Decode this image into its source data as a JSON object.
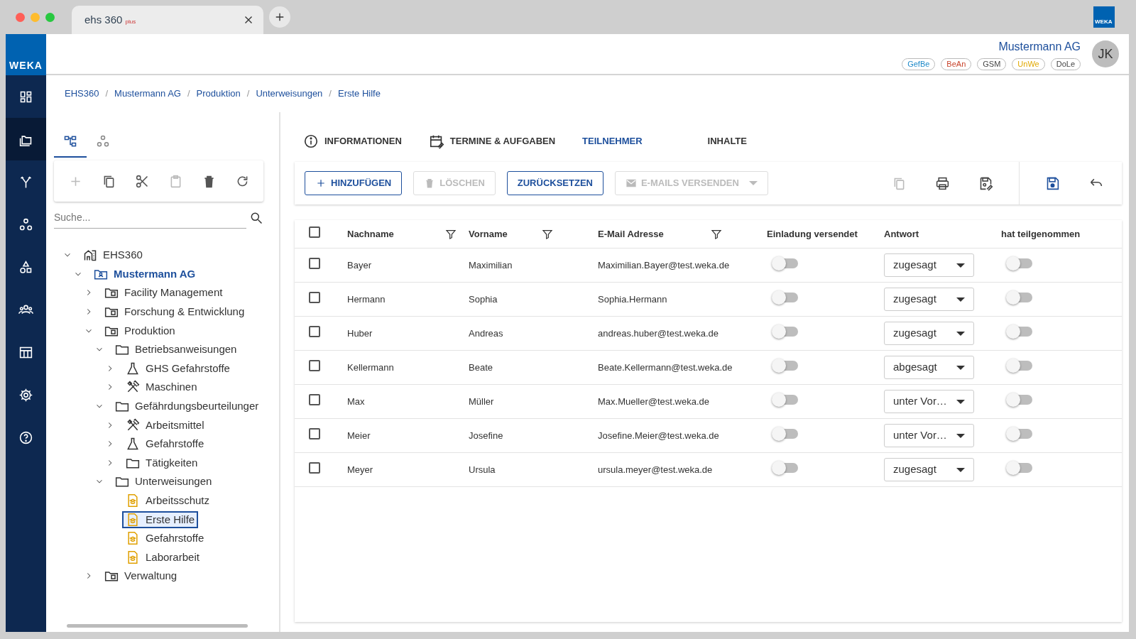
{
  "browser": {
    "tab_logo": "ehs 360",
    "tab_logo_suffix": "plus",
    "brand": "WEKA"
  },
  "sidebar": {
    "brand": "WEKA",
    "items": [
      {
        "selected": false
      },
      {
        "selected": true
      },
      {
        "selected": false
      },
      {
        "selected": false
      },
      {
        "selected": false
      },
      {
        "selected": false
      },
      {
        "selected": false
      },
      {
        "selected": false
      },
      {
        "selected": false
      }
    ]
  },
  "header": {
    "company": "Mustermann AG",
    "avatar": "JK",
    "tags": [
      {
        "label": "GefBe",
        "color": "#1f8ac9"
      },
      {
        "label": "BeAn",
        "color": "#c8442c"
      },
      {
        "label": "GSM",
        "color": "#444444"
      },
      {
        "label": "UnWe",
        "color": "#e0a800"
      },
      {
        "label": "DoLe",
        "color": "#444444"
      }
    ]
  },
  "breadcrumb": {
    "separator": "/",
    "items": [
      "EHS360",
      "Mustermann AG",
      "Produktion",
      "Unterweisungen",
      "Erste Hilfe"
    ]
  },
  "tree_panel": {
    "tabs": [
      {
        "selected": true
      },
      {
        "selected": false
      }
    ],
    "toolbar": [
      {
        "disabled": true
      },
      {
        "disabled": false
      },
      {
        "disabled": false
      },
      {
        "disabled": true
      },
      {
        "disabled": false
      },
      {
        "disabled": false
      }
    ],
    "search": {
      "placeholder": "Suche..."
    },
    "tree": [
      {
        "label": "EHS360",
        "kind": "building",
        "expanded": true,
        "selected": false,
        "children": [
          {
            "label": "Mustermann AG",
            "kind": "company",
            "expanded": true,
            "selected": false,
            "children": [
              {
                "label": "Facility Management",
                "kind": "unit",
                "expanded": false,
                "selected": false
              },
              {
                "label": "Forschung & Entwicklung",
                "kind": "unit",
                "expanded": false,
                "selected": false
              },
              {
                "label": "Produktion",
                "kind": "unit",
                "expanded": true,
                "selected": false,
                "children": [
                  {
                    "label": "Betriebsanweisungen",
                    "kind": "folder",
                    "expanded": true,
                    "selected": false,
                    "children": [
                      {
                        "label": "GHS Gefahrstoffe",
                        "kind": "flask",
                        "expanded": false,
                        "selected": false
                      },
                      {
                        "label": "Maschinen",
                        "kind": "tools",
                        "expanded": false,
                        "selected": false
                      }
                    ]
                  },
                  {
                    "label": "Gefährdungsbeurteilunger",
                    "kind": "folder",
                    "expanded": true,
                    "selected": false,
                    "children": [
                      {
                        "label": "Arbeitsmittel",
                        "kind": "tools",
                        "expanded": false,
                        "selected": false
                      },
                      {
                        "label": "Gefahrstoffe",
                        "kind": "flask",
                        "expanded": false,
                        "selected": false
                      },
                      {
                        "label": "Tätigkeiten",
                        "kind": "folder",
                        "expanded": false,
                        "selected": false
                      }
                    ]
                  },
                  {
                    "label": "Unterweisungen",
                    "kind": "folder",
                    "expanded": true,
                    "selected": false,
                    "children": [
                      {
                        "label": "Arbeitsschutz",
                        "kind": "document",
                        "selected": false
                      },
                      {
                        "label": "Erste Hilfe",
                        "kind": "document",
                        "selected": true
                      },
                      {
                        "label": "Gefahrstoffe",
                        "kind": "document",
                        "selected": false
                      },
                      {
                        "label": "Laborarbeit",
                        "kind": "document",
                        "selected": false
                      }
                    ]
                  }
                ]
              },
              {
                "label": "Verwaltung",
                "kind": "unit",
                "expanded": false,
                "selected": false
              }
            ]
          }
        ]
      }
    ]
  },
  "tabs": [
    {
      "label": "INFORMATIONEN",
      "selected": false
    },
    {
      "label": "TERMINE & AUFGABEN",
      "selected": false
    },
    {
      "label": "TEILNEHMER",
      "selected": true
    },
    {
      "label": "INHALTE",
      "selected": false
    }
  ],
  "actions": [
    {
      "label": "HINZUFÜGEN",
      "kind": "add",
      "disabled": false
    },
    {
      "label": "LÖSCHEN",
      "kind": "delete",
      "disabled": true
    },
    {
      "label": "ZURÜCKSETZEN",
      "kind": "plain",
      "disabled": false
    },
    {
      "label": "E-MAILS VERSENDEN",
      "kind": "mail",
      "disabled": true
    }
  ],
  "icon_tools": [
    {
      "disabled": true
    },
    {
      "disabled": false
    },
    {
      "disabled": false
    },
    {
      "disabled": false
    },
    {
      "disabled": false
    }
  ],
  "table": {
    "all_selected": false,
    "columns": [
      {
        "label": "Nachname",
        "filter": true
      },
      {
        "label": "Vorname",
        "filter": true
      },
      {
        "label": "E-Mail Adresse",
        "filter": true
      },
      {
        "label": "Einladung versendet",
        "filter": false
      },
      {
        "label": "Antwort",
        "filter": false
      },
      {
        "label": "hat teilgenommen",
        "filter": false
      }
    ],
    "rows": [
      {
        "selected": false,
        "nachname": "Bayer",
        "vorname": "Maximilian",
        "email": "Maximilian.Bayer@test.weka.de",
        "invited": false,
        "answer": "zugesagt",
        "attended": false
      },
      {
        "selected": false,
        "nachname": "Hermann",
        "vorname": "Sophia",
        "email": "Sophia.Hermann",
        "invited": false,
        "answer": "zugesagt",
        "attended": false
      },
      {
        "selected": false,
        "nachname": "Huber",
        "vorname": "Andreas",
        "email": "andreas.huber@test.weka.de",
        "invited": false,
        "answer": "zugesagt",
        "attended": false
      },
      {
        "selected": false,
        "nachname": "Kellermann",
        "vorname": "Beate",
        "email": "Beate.Kellermann@test.weka.de",
        "invited": false,
        "answer": "abgesagt",
        "attended": false
      },
      {
        "selected": false,
        "nachname": "Max",
        "vorname": "Müller",
        "email": "Max.Mueller@test.weka.de",
        "invited": false,
        "answer": "unter Vor…",
        "attended": false
      },
      {
        "selected": false,
        "nachname": "Meier",
        "vorname": "Josefine",
        "email": "Josefine.Meier@test.weka.de",
        "invited": false,
        "answer": "unter Vor…",
        "attended": false
      },
      {
        "selected": false,
        "nachname": "Meyer",
        "vorname": "Ursula",
        "email": "ursula.meyer@test.weka.de",
        "invited": false,
        "answer": "zugesagt",
        "attended": false
      }
    ]
  }
}
